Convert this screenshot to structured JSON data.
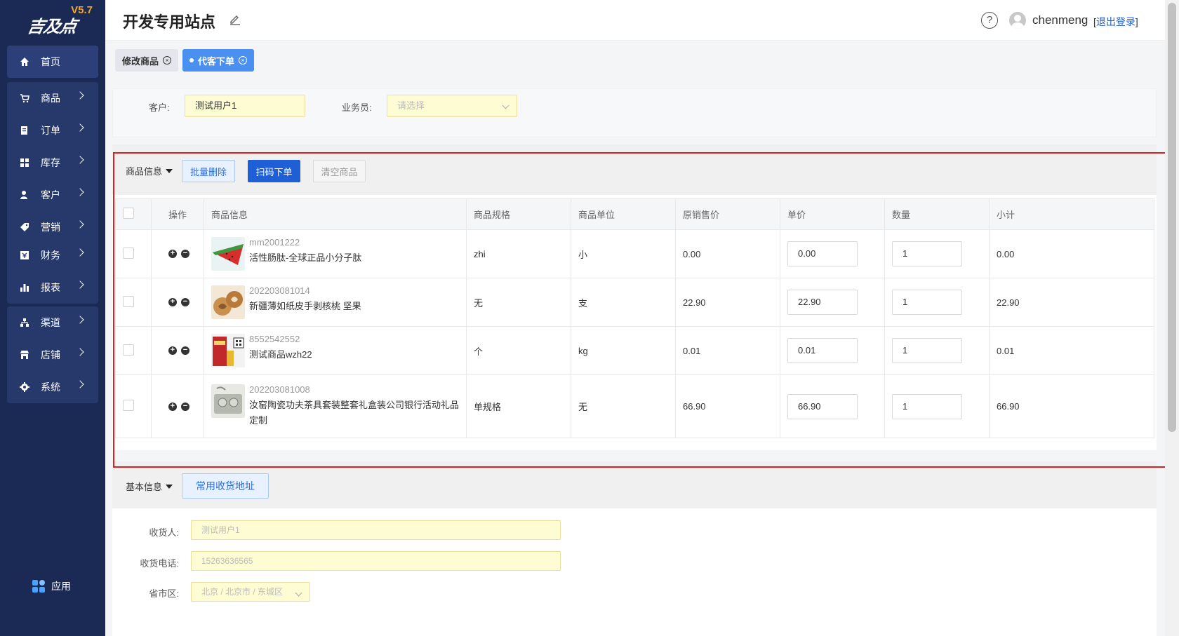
{
  "brand": {
    "logo_text": "吉及点",
    "version": "V5.7"
  },
  "sidebar": {
    "items": [
      {
        "label": "首页",
        "icon": "home-icon"
      },
      {
        "label": "商品",
        "icon": "cart-icon"
      },
      {
        "label": "订单",
        "icon": "order-icon"
      },
      {
        "label": "库存",
        "icon": "inventory-icon"
      },
      {
        "label": "客户",
        "icon": "customer-icon"
      },
      {
        "label": "营销",
        "icon": "tag-icon"
      },
      {
        "label": "财务",
        "icon": "finance-icon"
      },
      {
        "label": "报表",
        "icon": "chart-icon"
      },
      {
        "label": "渠道",
        "icon": "channel-icon"
      },
      {
        "label": "店铺",
        "icon": "store-icon"
      },
      {
        "label": "系统",
        "icon": "gear-icon"
      }
    ],
    "apps_label": "应用"
  },
  "header": {
    "site_title": "开发专用站点",
    "help": "?",
    "username": "chenmeng",
    "logout_open": "[",
    "logout_label": "退出登录",
    "logout_close": "]"
  },
  "tabs": [
    {
      "label": "修改商品",
      "active": false
    },
    {
      "label": "代客下单",
      "active": true
    }
  ],
  "customer": {
    "customer_label": "客户:",
    "customer_value": "测试用户1",
    "salesman_label": "业务员:",
    "salesman_placeholder": "请选择"
  },
  "goods": {
    "section_title": "商品信息",
    "batch_delete": "批量删除",
    "scan_order": "扫码下单",
    "clear_goods": "清空商品",
    "columns": [
      "操作",
      "商品信息",
      "商品规格",
      "商品单位",
      "原销售价",
      "单价",
      "数量",
      "小计"
    ],
    "rows": [
      {
        "code": "mm2001222",
        "name": "活性肠肽-全球正品小分子肽",
        "spec": "zhi",
        "unit": "小",
        "orig_price": "0.00",
        "price": "0.00",
        "qty": "1",
        "subtotal": "0.00"
      },
      {
        "code": "202203081014",
        "name": "新疆薄如纸皮手剥核桃 坚果",
        "spec": "无",
        "unit": "支",
        "orig_price": "22.90",
        "price": "22.90",
        "qty": "1",
        "subtotal": "22.90"
      },
      {
        "code": "8552542552",
        "name": "测试商品wzh22",
        "spec": "个",
        "unit": "kg",
        "orig_price": "0.01",
        "price": "0.01",
        "qty": "1",
        "subtotal": "0.01"
      },
      {
        "code": "202203081008",
        "name": "汝窑陶瓷功夫茶具套装整套礼盒装公司银行活动礼品定制",
        "spec": "单规格",
        "unit": "无",
        "orig_price": "66.90",
        "price": "66.90",
        "qty": "1",
        "subtotal": "66.90"
      }
    ]
  },
  "base": {
    "section_title": "基本信息",
    "address_button": "常用收货地址",
    "receiver_label": "收货人:",
    "receiver_value": "测试用户1",
    "phone_label": "收货电话:",
    "phone_value": "15263636565",
    "region_label": "省市区:",
    "region_value": "北京 / 北京市 / 东城区"
  },
  "colors": {
    "sidebar": "#1b2a55",
    "primary": "#1f5fd6",
    "highlight_border": "#e02020",
    "input_yellow": "#fefcd2"
  }
}
